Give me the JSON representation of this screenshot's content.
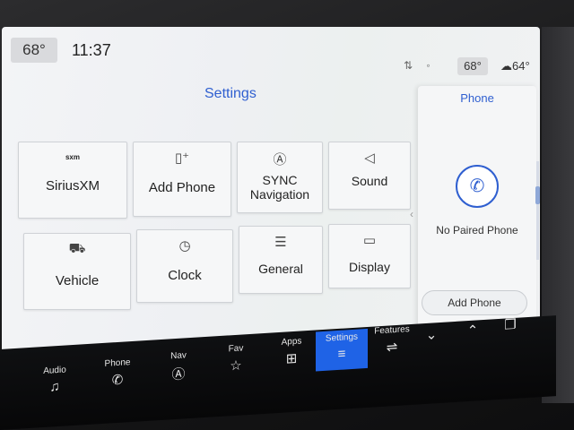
{
  "status": {
    "temp_left": "68°",
    "time": "11:37",
    "icons": "⇅ ◦",
    "temp_right": "68°",
    "outside_temp": "64°"
  },
  "settings": {
    "title": "Settings",
    "tiles": [
      {
        "label": "SiriusXM",
        "icon": "sxm"
      },
      {
        "label": "Add Phone",
        "icon": "phone-plus-icon"
      },
      {
        "label": "SYNC Navigation",
        "icon": "navigation-icon"
      },
      {
        "label": "Sound",
        "icon": "speaker-icon"
      },
      {
        "label": "Vehicle",
        "icon": "vehicle-icon"
      },
      {
        "label": "Clock",
        "icon": "clock-icon"
      },
      {
        "label": "General",
        "icon": "sliders-icon"
      },
      {
        "label": "Display",
        "icon": "display-icon"
      }
    ]
  },
  "phone_panel": {
    "title": "Phone",
    "status": "No Paired Phone",
    "button": "Add Phone"
  },
  "nav": {
    "items": [
      {
        "label": "Audio",
        "icon": "♫"
      },
      {
        "label": "Phone",
        "icon": "✆"
      },
      {
        "label": "Nav",
        "icon": "Ⓐ"
      },
      {
        "label": "Fav",
        "icon": "☆"
      },
      {
        "label": "Apps",
        "icon": "⊞"
      },
      {
        "label": "Settings",
        "icon": "≡"
      },
      {
        "label": "Features",
        "icon": "⇌"
      },
      {
        "label": "",
        "icon": "⌄"
      },
      {
        "label": "",
        "icon": "⌃"
      },
      {
        "label": "",
        "icon": "❐"
      }
    ],
    "active": "Settings"
  },
  "colors": {
    "accent": "#2f5fd0",
    "active_nav": "#1f63e6"
  }
}
